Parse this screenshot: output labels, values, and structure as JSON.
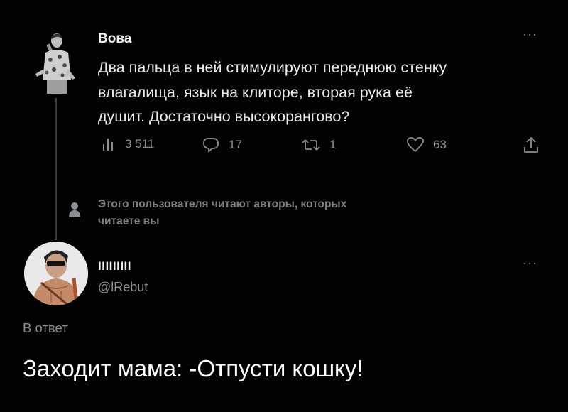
{
  "tweet1": {
    "author_name": "Вова",
    "more": "···",
    "text_lines": [
      "Два пальца в ней стимулируют переднюю стенку",
      "влагалища, язык на клиторе, вторая рука её",
      "душит. Достаточно высокорангово?"
    ],
    "actions": {
      "views": "3 511",
      "replies": "17",
      "reposts": "1",
      "likes": "63"
    }
  },
  "follow_notice": {
    "lines": [
      "Этого пользователя читают авторы, которых",
      "читаете вы"
    ]
  },
  "tweet2": {
    "author_name": "IIIIIIIII",
    "handle": "@lRebut",
    "more": "···",
    "reply_label": "В ответ",
    "text": "Заходит мама: -Отпусти кошку!"
  },
  "colors": {
    "background": "#000000",
    "text": "#e7e9ea",
    "muted": "#8b8f94",
    "thread_line": "#3a3d40"
  }
}
